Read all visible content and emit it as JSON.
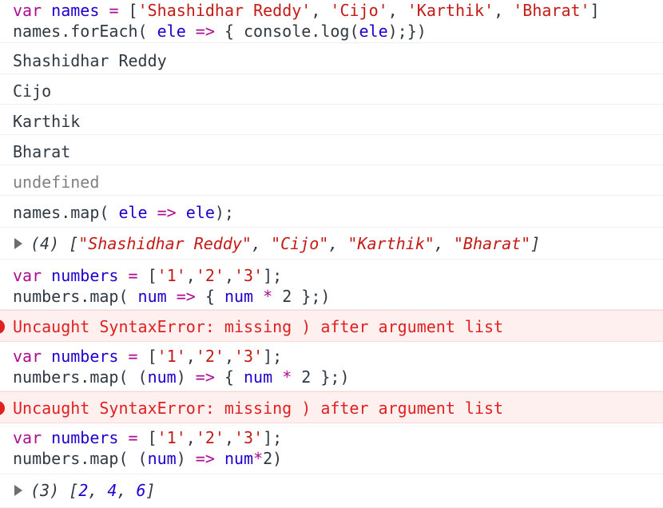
{
  "entries": [
    {
      "type": "input",
      "lines": [
        [
          [
            "kw",
            "var"
          ],
          [
            "plain",
            " "
          ],
          [
            "var",
            "names"
          ],
          [
            "plain",
            " "
          ],
          [
            "op",
            "="
          ],
          [
            "plain",
            " ["
          ],
          [
            "str",
            "'Shashidhar Reddy'"
          ],
          [
            "plain",
            ", "
          ],
          [
            "str",
            "'Cijo'"
          ],
          [
            "plain",
            ", "
          ],
          [
            "str",
            "'Karthik'"
          ],
          [
            "plain",
            ", "
          ],
          [
            "str",
            "'Bharat'"
          ],
          [
            "plain",
            "]"
          ]
        ],
        [
          [
            "plain",
            "names.forEach( "
          ],
          [
            "var",
            "ele"
          ],
          [
            "plain",
            " "
          ],
          [
            "op",
            "=>"
          ],
          [
            "plain",
            " { console.log("
          ],
          [
            "var",
            "ele"
          ],
          [
            "plain",
            ");})"
          ]
        ]
      ]
    },
    {
      "type": "log",
      "text": "Shashidhar Reddy"
    },
    {
      "type": "log",
      "text": "Cijo"
    },
    {
      "type": "log",
      "text": "Karthik"
    },
    {
      "type": "log",
      "text": "Bharat"
    },
    {
      "type": "undefined",
      "text": "undefined"
    },
    {
      "type": "input",
      "lines": [
        [
          [
            "plain",
            "names.map( "
          ],
          [
            "var",
            "ele"
          ],
          [
            "plain",
            " "
          ],
          [
            "op",
            "=>"
          ],
          [
            "plain",
            " "
          ],
          [
            "var",
            "ele"
          ],
          [
            "plain",
            ");"
          ]
        ]
      ]
    },
    {
      "type": "result-array",
      "parts": [
        [
          "plain",
          "(4) ["
        ],
        [
          "str",
          "\"Shashidhar Reddy\""
        ],
        [
          "plain",
          ", "
        ],
        [
          "str",
          "\"Cijo\""
        ],
        [
          "plain",
          ", "
        ],
        [
          "str",
          "\"Karthik\""
        ],
        [
          "plain",
          ", "
        ],
        [
          "str",
          "\"Bharat\""
        ],
        [
          "plain",
          "]"
        ]
      ]
    },
    {
      "type": "input",
      "lines": [
        [
          [
            "kw",
            "var"
          ],
          [
            "plain",
            " "
          ],
          [
            "var",
            "numbers"
          ],
          [
            "plain",
            " "
          ],
          [
            "op",
            "="
          ],
          [
            "plain",
            " ["
          ],
          [
            "str",
            "'1'"
          ],
          [
            "plain",
            ","
          ],
          [
            "str",
            "'2'"
          ],
          [
            "plain",
            ","
          ],
          [
            "str",
            "'3'"
          ],
          [
            "plain",
            "];"
          ]
        ],
        [
          [
            "plain",
            "numbers.map( "
          ],
          [
            "var",
            "num"
          ],
          [
            "plain",
            " "
          ],
          [
            "op",
            "=>"
          ],
          [
            "plain",
            " { "
          ],
          [
            "var",
            "num"
          ],
          [
            "plain",
            " "
          ],
          [
            "op",
            "*"
          ],
          [
            "plain",
            " 2 };)"
          ]
        ]
      ]
    },
    {
      "type": "error",
      "text": "Uncaught SyntaxError: missing ) after argument list"
    },
    {
      "type": "input",
      "lines": [
        [
          [
            "kw",
            "var"
          ],
          [
            "plain",
            " "
          ],
          [
            "var",
            "numbers"
          ],
          [
            "plain",
            " "
          ],
          [
            "op",
            "="
          ],
          [
            "plain",
            " ["
          ],
          [
            "str",
            "'1'"
          ],
          [
            "plain",
            ","
          ],
          [
            "str",
            "'2'"
          ],
          [
            "plain",
            ","
          ],
          [
            "str",
            "'3'"
          ],
          [
            "plain",
            "];"
          ]
        ],
        [
          [
            "plain",
            "numbers.map( ("
          ],
          [
            "var",
            "num"
          ],
          [
            "plain",
            ") "
          ],
          [
            "op",
            "=>"
          ],
          [
            "plain",
            " { "
          ],
          [
            "var",
            "num"
          ],
          [
            "plain",
            " "
          ],
          [
            "op",
            "*"
          ],
          [
            "plain",
            " 2 };)"
          ]
        ]
      ]
    },
    {
      "type": "error",
      "text": "Uncaught SyntaxError: missing ) after argument list"
    },
    {
      "type": "input",
      "lines": [
        [
          [
            "kw",
            "var"
          ],
          [
            "plain",
            " "
          ],
          [
            "var",
            "numbers"
          ],
          [
            "plain",
            " "
          ],
          [
            "op",
            "="
          ],
          [
            "plain",
            " ["
          ],
          [
            "str",
            "'1'"
          ],
          [
            "plain",
            ","
          ],
          [
            "str",
            "'2'"
          ],
          [
            "plain",
            ","
          ],
          [
            "str",
            "'3'"
          ],
          [
            "plain",
            "];"
          ]
        ],
        [
          [
            "plain",
            "numbers.map( ("
          ],
          [
            "var",
            "num"
          ],
          [
            "plain",
            ") "
          ],
          [
            "op",
            "=>"
          ],
          [
            "plain",
            " "
          ],
          [
            "var",
            "num"
          ],
          [
            "op",
            "*"
          ],
          [
            "plain",
            "2)"
          ]
        ]
      ]
    },
    {
      "type": "result-array",
      "parts": [
        [
          "plain",
          "(3) ["
        ],
        [
          "num",
          "2"
        ],
        [
          "plain",
          ", "
        ],
        [
          "num",
          "4"
        ],
        [
          "plain",
          ", "
        ],
        [
          "num",
          "6"
        ],
        [
          "plain",
          "]"
        ]
      ]
    }
  ]
}
